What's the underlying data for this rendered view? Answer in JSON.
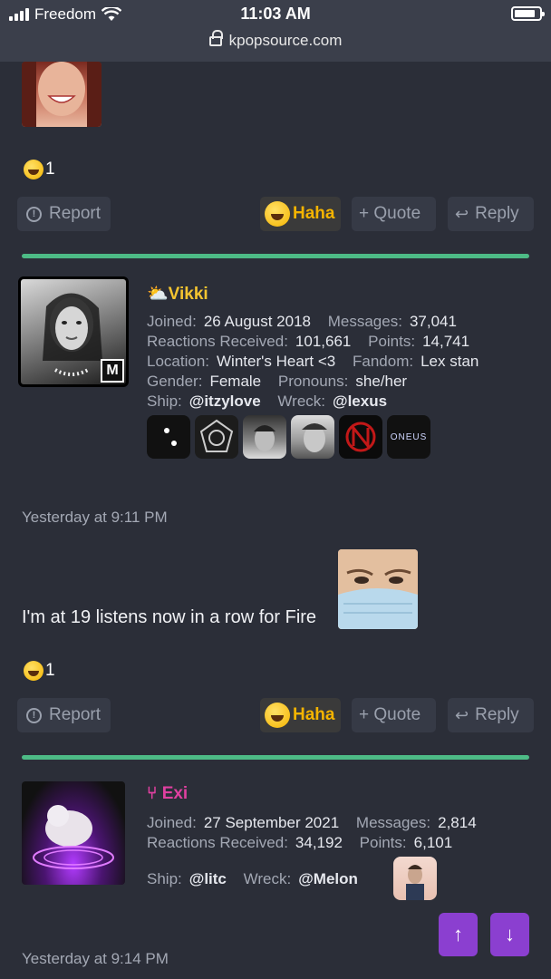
{
  "status_bar": {
    "carrier": "Freedom",
    "time": "11:03 AM",
    "url": "kpopsource.com"
  },
  "post1": {
    "reaction_count": "1",
    "actions": {
      "report": "Report",
      "haha": "Haha",
      "quote": "+ Quote",
      "reply": "Reply"
    }
  },
  "post2": {
    "username": "Vikki",
    "username_color": "#f4c430",
    "rows": [
      [
        {
          "k": "Joined:",
          "v": "26 August 2018"
        },
        {
          "k": "Messages:",
          "v": "37,041"
        }
      ],
      [
        {
          "k": "Reactions Received:",
          "v": "101,661"
        },
        {
          "k": "Points:",
          "v": "14,741"
        }
      ],
      [
        {
          "k": "Location:",
          "v": "Winter's Heart <3"
        },
        {
          "k": "Fandom:",
          "v": "Lex stan"
        }
      ],
      [
        {
          "k": "Gender:",
          "v": "Female"
        },
        {
          "k": "Pronouns:",
          "v": "she/her"
        }
      ],
      [
        {
          "k": "Ship:",
          "v": "@itzylove"
        },
        {
          "k": "Wreck:",
          "v": "@lexus"
        }
      ]
    ],
    "badge_text": "ONEUS",
    "timestamp": "Yesterday at 9:11 PM",
    "message": "I'm at 19 listens now in a row for Fire",
    "reaction_count": "1",
    "actions": {
      "report": "Report",
      "haha": "Haha",
      "quote": "+ Quote",
      "reply": "Reply"
    }
  },
  "post3": {
    "username": "Exi",
    "username_color": "#e040a0",
    "rows": [
      [
        {
          "k": "Joined:",
          "v": "27 September 2021"
        },
        {
          "k": "Messages:",
          "v": "2,814"
        }
      ],
      [
        {
          "k": "Reactions Received:",
          "v": "34,192"
        },
        {
          "k": "Points:",
          "v": "6,101"
        }
      ],
      [
        {
          "k": "Ship:",
          "v": "@litc"
        },
        {
          "k": "Wreck:",
          "v": "@Melon"
        }
      ]
    ],
    "timestamp": "Yesterday at 9:14 PM"
  },
  "accent": "#4dbb86",
  "nav_color": "#8b3fd0"
}
